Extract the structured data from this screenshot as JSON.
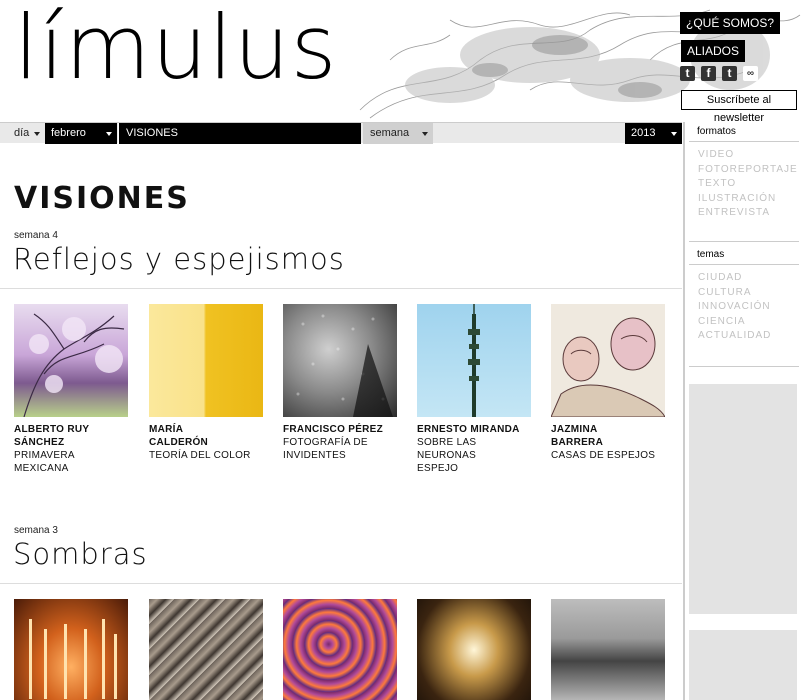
{
  "header": {
    "logo": "límulus",
    "about_button": "¿QUÉ SOMOS?",
    "allies_button": "ALIADOS",
    "social": [
      "twitter-icon",
      "facebook-icon",
      "tumblr-icon",
      "flickr-icon"
    ],
    "newsletter": "Suscríbete al newsletter"
  },
  "nav": {
    "day": "día",
    "month": "febrero",
    "section": "VISIONES",
    "week": "semana",
    "year": "2013"
  },
  "main": {
    "title": "VISIONES",
    "weeks": [
      {
        "label": "semana 4",
        "title": "Reflejos y espejismos",
        "items": [
          {
            "author_line1": "ALBERTO RUY",
            "author_line2": "SÁNCHEZ",
            "work_line1": "PRIMAVERA MEXICANA",
            "work_line2": ""
          },
          {
            "author_line1": "MARÍA",
            "author_line2": "CALDERÓN",
            "work_line1": "TEORÍA DEL COLOR",
            "work_line2": ""
          },
          {
            "author_line1": "FRANCISCO PÉREZ",
            "author_line2": "",
            "work_line1": "FOTOGRAFÍA DE",
            "work_line2": "INVIDENTES"
          },
          {
            "author_line1": "ERNESTO MIRANDA",
            "author_line2": "",
            "work_line1": "SOBRE LAS NEURONAS",
            "work_line2": "ESPEJO"
          },
          {
            "author_line1": "JAZMINA",
            "author_line2": "BARRERA",
            "work_line1": "CASAS DE ESPEJOS",
            "work_line2": ""
          }
        ]
      },
      {
        "label": "semana 3",
        "title": "Sombras"
      }
    ]
  },
  "sidebar": {
    "formats_heading": "formatos",
    "formats": [
      "VIDEO",
      "FOTOREPORTAJE",
      "TEXTO",
      "ILUSTRACIÓN",
      "ENTREVISTA"
    ],
    "topics_heading": "temas",
    "topics": [
      "CIUDAD",
      "CULTURA",
      "INNOVACIÓN",
      "CIENCIA",
      "ACTUALIDAD"
    ]
  },
  "colors": {
    "accent": "#000000",
    "nav_bg": "#e9e9e9",
    "muted": "#c2c2c2",
    "ad": "#e3e3e3"
  }
}
